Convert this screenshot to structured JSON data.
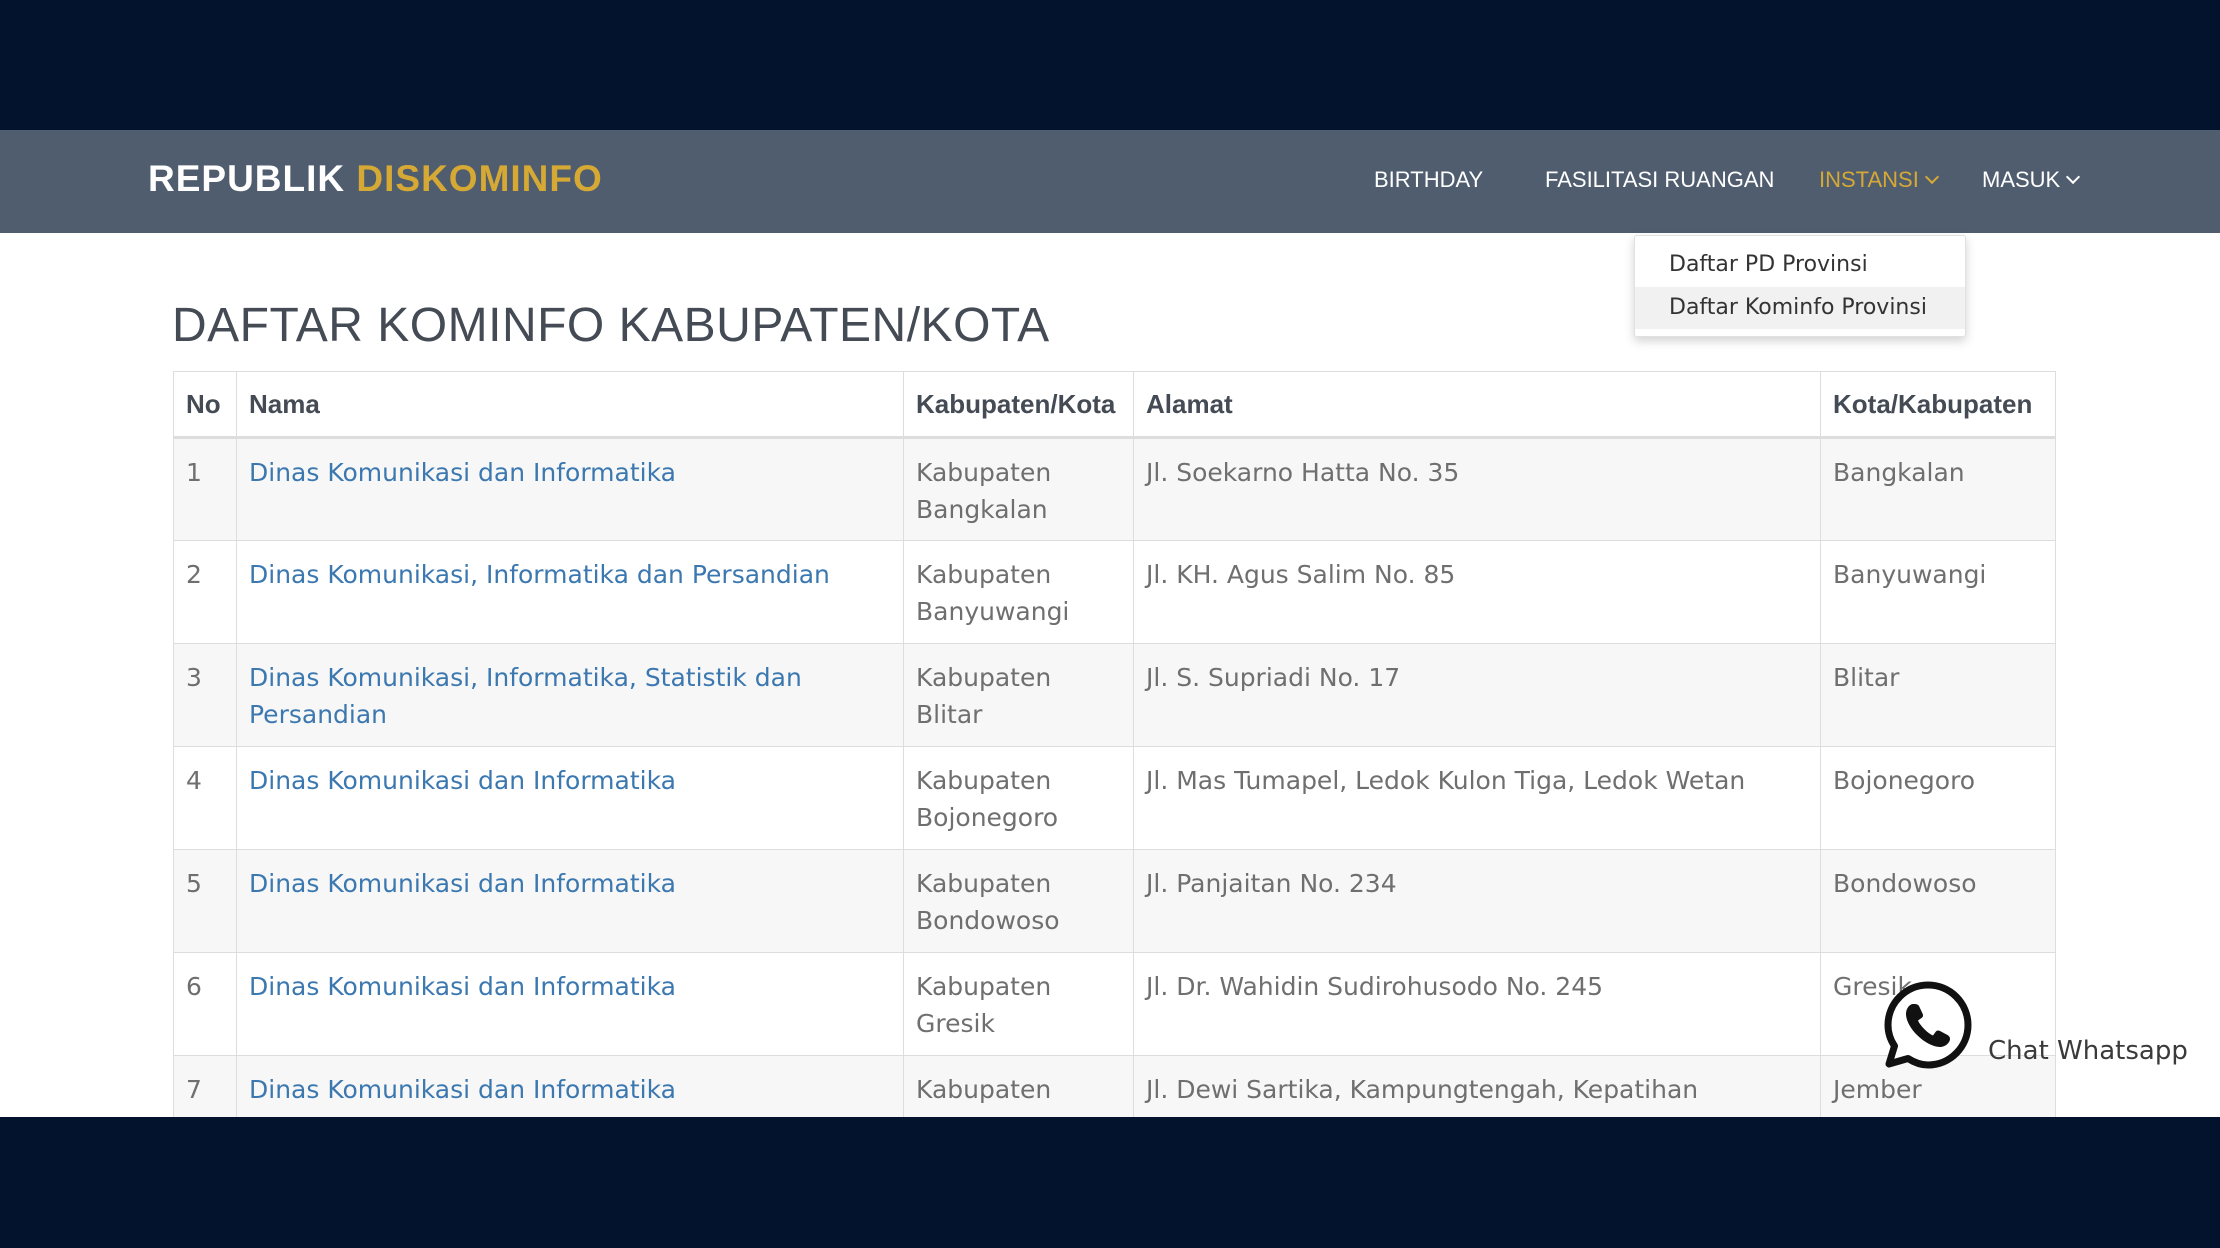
{
  "brand": {
    "part1": "REPUBLIK",
    "part2": "DISKOMINFO"
  },
  "nav": [
    {
      "label": "BIRTHDAY"
    },
    {
      "label": "FASILITASI RUANGAN"
    },
    {
      "label": "INSTANSI"
    },
    {
      "label": "MASUK"
    }
  ],
  "dropdown": [
    {
      "label": "Daftar PD Provinsi"
    },
    {
      "label": "Daftar Kominfo Provinsi"
    }
  ],
  "page_title": "DAFTAR KOMINFO KABUPATEN/KOTA",
  "table": {
    "headers": [
      "No",
      "Nama",
      "Kabupaten/Kota",
      "Alamat",
      "Kota/Kabupaten"
    ],
    "rows": [
      {
        "no": "1",
        "nama": "Dinas Komunikasi dan Informatika",
        "kab1": "Kabupaten",
        "kab2": "Bangkalan",
        "alamat": "Jl. Soekarno Hatta No. 35",
        "kota": "Bangkalan"
      },
      {
        "no": "2",
        "nama": "Dinas Komunikasi, Informatika dan Persandian",
        "kab1": "Kabupaten",
        "kab2": "Banyuwangi",
        "alamat": "Jl. KH. Agus Salim No. 85",
        "kota": "Banyuwangi"
      },
      {
        "no": "3",
        "nama": "Dinas Komunikasi, Informatika, Statistik dan Persandian",
        "kab1": "Kabupaten",
        "kab2": "Blitar",
        "alamat": "Jl. S. Supriadi No. 17",
        "kota": "Blitar"
      },
      {
        "no": "4",
        "nama": "Dinas Komunikasi dan Informatika",
        "kab1": "Kabupaten",
        "kab2": "Bojonegoro",
        "alamat": "Jl. Mas Tumapel, Ledok Kulon Tiga, Ledok Wetan",
        "kota": "Bojonegoro"
      },
      {
        "no": "5",
        "nama": "Dinas Komunikasi dan Informatika",
        "kab1": "Kabupaten",
        "kab2": "Bondowoso",
        "alamat": "Jl. Panjaitan No. 234",
        "kota": "Bondowoso"
      },
      {
        "no": "6",
        "nama": "Dinas Komunikasi dan Informatika",
        "kab1": "Kabupaten",
        "kab2": "Gresik",
        "alamat": "Jl. Dr. Wahidin Sudirohusodo No. 245",
        "kota": "Gresik"
      },
      {
        "no": "7",
        "nama": "Dinas Komunikasi dan Informatika",
        "kab1": "Kabupaten",
        "kab2": "",
        "alamat": "Jl. Dewi Sartika, Kampungtengah, Kepatihan",
        "kota": "Jember"
      }
    ]
  },
  "whatsapp": {
    "label": "Chat Whatsapp"
  },
  "colors": {
    "frame": "#03132e",
    "navbar": "#4f5d6f",
    "accent": "#d6a935",
    "link": "#3c78b0"
  }
}
